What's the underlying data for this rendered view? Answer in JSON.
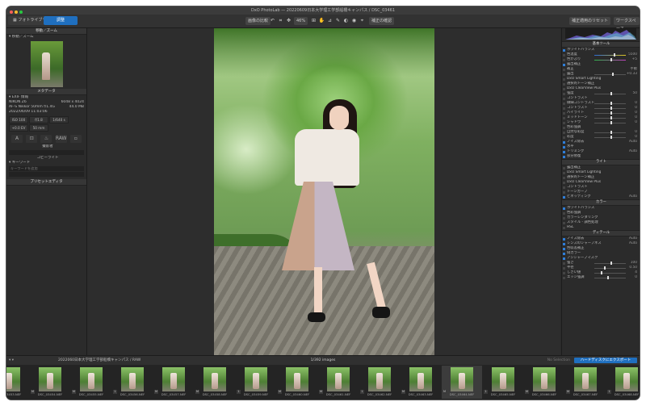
{
  "window": {
    "title": "DxO PhotoLab — 20220609日本大学理工学部船橋キャンパス / DSC_03461",
    "traffic_colors": [
      "#ff5f57",
      "#febc2e",
      "#28c840"
    ]
  },
  "toolbar": {
    "tab_library": "フォトライブラリ",
    "tab_customize": "調整",
    "compare": "画像の比較",
    "zoom": "46%",
    "repair": "Ⅰ",
    "show_mask": "補正の確認",
    "right_display": "補正適用のリセット",
    "workspace": "ワークスペース"
  },
  "left_panel": {
    "nav_header": "移動／ズーム",
    "nav_row": "▾ 移動／ズーム",
    "meta_header": "メタデータ",
    "exif_title": "▾ EXIF 情報",
    "camera": "NIKON Z6",
    "size": "6048 x 4024",
    "lens": "AF-S Nikkor 50mm f/1.4G",
    "file_size": "44.0 MB",
    "date": "2022/06/09 11:03:06",
    "exif": [
      "ISO 100",
      "f/1.8",
      "1/640 s",
      "+0.0 EV",
      "50 mm"
    ],
    "exif_icons": [
      "A",
      "⊡",
      "♨",
      "RAW",
      "▫"
    ],
    "extra_labels": [
      "撮影者",
      "コピーライト"
    ],
    "keyword_title": "▾ キーワード",
    "keyword_placeholder": "キーワードを追加",
    "preset_header": "プリセットエディタ"
  },
  "right_panel": {
    "histogram_label": "ヒストグラム",
    "sections": [
      {
        "header": "基本ツール",
        "rows": [
          {
            "label": "ホワイトバランス",
            "val": "",
            "on": true
          },
          {
            "label": "色温度",
            "val": "5500",
            "slider": "c1",
            "knob": 0.62
          },
          {
            "label": "色かぶり",
            "val": "+5",
            "slider": "c2",
            "knob": 0.52
          },
          {
            "label": "露出補正",
            "val": "",
            "on": true
          },
          {
            "label": "補正",
            "val": "手動",
            "slider": "",
            "knob": 0.5
          },
          {
            "label": "露出",
            "val": "+0.33",
            "slider": "plain",
            "knob": 0.56
          },
          {
            "label": "DxO Smart Lighting",
            "val": ""
          },
          {
            "label": "選択的トーン補正",
            "val": ""
          },
          {
            "label": "DxO ClearView Plus",
            "val": ""
          },
          {
            "label": "強度",
            "val": "50",
            "slider": "plain",
            "knob": 0.5
          },
          {
            "label": "コントラスト",
            "val": ""
          },
          {
            "label": "微細コントラスト",
            "val": "0",
            "slider": "plain",
            "knob": 0.5
          },
          {
            "label": "コントラスト",
            "val": "0",
            "slider": "plain",
            "knob": 0.5
          },
          {
            "label": "ハイライト",
            "val": "0",
            "slider": "plain",
            "knob": 0.5
          },
          {
            "label": "ミッドトーン",
            "val": "0",
            "slider": "plain",
            "knob": 0.5
          },
          {
            "label": "シャドウ",
            "val": "0",
            "slider": "plain",
            "knob": 0.5
          },
          {
            "label": "色彩強調",
            "val": ""
          },
          {
            "label": "自然な彩度",
            "val": "0",
            "slider": "plain",
            "knob": 0.5
          },
          {
            "label": "彩度",
            "val": "0",
            "slider": "plain",
            "knob": 0.5
          },
          {
            "label": "ノイズ除去",
            "val": "Auto",
            "on": true
          },
          {
            "label": "水平",
            "val": "",
            "on": true
          },
          {
            "label": "トリミング",
            "val": "Auto",
            "on": true
          },
          {
            "label": "部分修復",
            "val": "",
            "on": true
          }
        ]
      },
      {
        "header": "ライト",
        "rows": [
          {
            "label": "露出補正",
            "val": ""
          },
          {
            "label": "DxO Smart Lighting",
            "val": ""
          },
          {
            "label": "選択的トーン補正",
            "val": ""
          },
          {
            "label": "DxO ClearView Plus",
            "val": ""
          },
          {
            "label": "コントラスト",
            "val": ""
          },
          {
            "label": "トーンカーブ",
            "val": ""
          },
          {
            "label": "ビネッティング",
            "val": "Auto",
            "on": true
          }
        ]
      },
      {
        "header": "カラー",
        "rows": [
          {
            "label": "ホワイトバランス",
            "val": "",
            "on": true
          },
          {
            "label": "色彩強調",
            "val": ""
          },
          {
            "label": "カラーレンダリング",
            "val": ""
          },
          {
            "label": "スタイル - 調色処理",
            "val": ""
          },
          {
            "label": "HSL",
            "val": ""
          }
        ]
      },
      {
        "header": "ディテール",
        "rows": [
          {
            "label": "ノイズ除去",
            "val": "Auto",
            "on": true
          },
          {
            "label": "レンズのシャープネス",
            "val": "Auto",
            "on": true
          },
          {
            "label": "色収差補正",
            "val": "",
            "on": true
          },
          {
            "label": "偽カラー",
            "val": "",
            "on": true
          },
          {
            "label": "アンシャープマスク",
            "val": "",
            "on": true
          },
          {
            "label": "強さ",
            "val": "100",
            "slider": "plain",
            "knob": 0.5
          },
          {
            "label": "半径",
            "val": "0.50",
            "slider": "plain",
            "knob": 0.3
          },
          {
            "label": "しきい値",
            "val": "4",
            "slider": "plain",
            "knob": 0.2
          },
          {
            "label": "エッジ強調",
            "val": "0",
            "slider": "plain",
            "knob": 0.4
          }
        ]
      }
    ]
  },
  "filmbar": {
    "filter": "▾ ▾",
    "path": "2022060日本大学理工学部船橋キャンパス / RAW",
    "count": "1/392 images",
    "notice": "No Selection",
    "export": "ハードディスクにエクスポート"
  },
  "filmstrip": [
    {
      "name": "DSC_03453.NEF",
      "flag": "1"
    },
    {
      "name": "DSC_03454.NEF",
      "flag": "M"
    },
    {
      "name": "DSC_03455.NEF",
      "flag": "M"
    },
    {
      "name": "DSC_03456.NEF",
      "flag": "1"
    },
    {
      "name": "DSC_03457.NEF",
      "flag": "M"
    },
    {
      "name": "DSC_03458.NEF",
      "flag": "M"
    },
    {
      "name": "DSC_03459.NEF",
      "flag": "1"
    },
    {
      "name": "DSC_03460.NEF",
      "flag": "M"
    },
    {
      "name": "DSC_03461.NEF",
      "flag": "M"
    },
    {
      "name": "DSC_03462.NEF",
      "flag": "1"
    },
    {
      "name": "DSC_03463.NEF",
      "flag": "M"
    },
    {
      "name": "DSC_03464.NEF",
      "flag": "M"
    },
    {
      "name": "DSC_03465.NEF",
      "flag": "1"
    },
    {
      "name": "DSC_03466.NEF",
      "flag": "M"
    },
    {
      "name": "DSC_03467.NEF",
      "flag": "M"
    },
    {
      "name": "DSC_03468.NEF",
      "flag": "1"
    }
  ],
  "filmstrip_selected": 11
}
